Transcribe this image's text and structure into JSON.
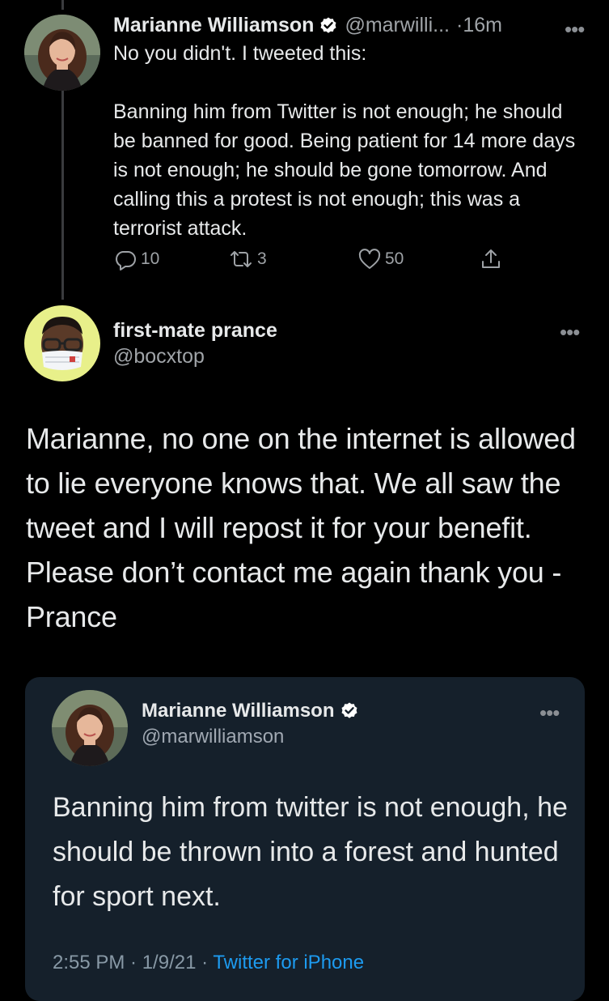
{
  "theme": {
    "background": "#000000",
    "quote_card_background": "#15202b",
    "link_color": "#1d9bf0",
    "verified_color": "#ffffff"
  },
  "tweet1": {
    "display_name": "Marianne Williamson",
    "verified": true,
    "handle": "@marwilli...",
    "separator": "·",
    "time": "16m",
    "more_icon": "more-horizontal-icon",
    "text": "No you didn't. I tweeted this:\n\nBanning him from Twitter is not enough; he should be banned for good. Being patient for 14 more days is not enough; he should be gone tomorrow. And calling this a protest is not enough; this was a terrorist attack.",
    "actions": {
      "reply_count": "10",
      "retweet_count": "3",
      "like_count": "50"
    }
  },
  "tweet2": {
    "display_name": "first-mate prance",
    "handle": "@bocxtop",
    "more_icon": "more-horizontal-icon",
    "text": "Marianne, no one on the internet is allowed to lie everyone knows that. We all saw the tweet and I will repost it for your benefit. Please don’t contact me again thank you -Prance"
  },
  "quoted_tweet": {
    "display_name": "Marianne Williamson",
    "verified": true,
    "handle": "@marwilliamson",
    "text": "Banning him from twitter is not enough, he should be thrown into a forest and hunted for sport next.",
    "timestamp": "2:55 PM · 1/9/21 · ",
    "source": "Twitter for iPhone"
  }
}
